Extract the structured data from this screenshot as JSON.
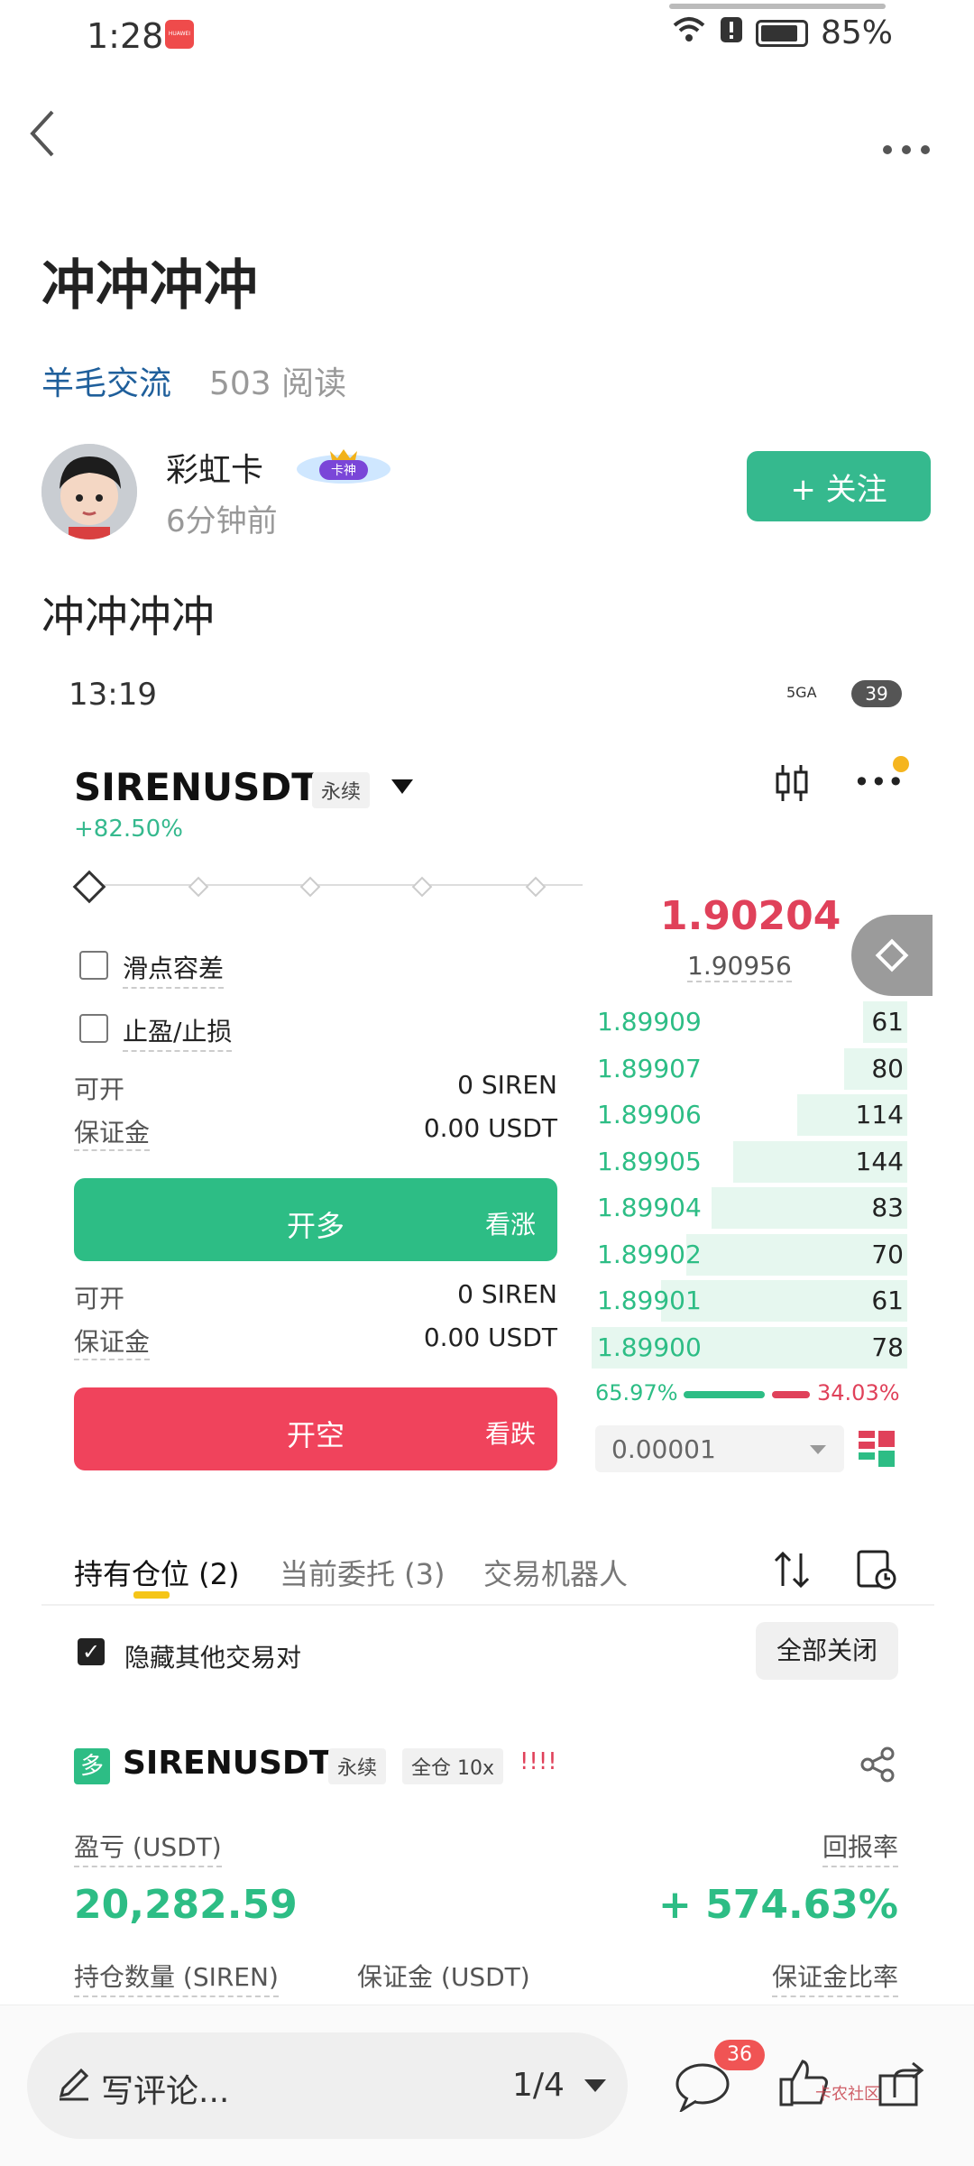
{
  "status_bar": {
    "time": "1:28",
    "battery": "85%"
  },
  "header": {
    "back_icon": "chevron-left-icon",
    "more_icon": "more-dots-icon"
  },
  "post": {
    "title": "冲冲冲冲",
    "category": "羊毛交流",
    "reads": "503 阅读",
    "author": {
      "name": "彩虹卡",
      "badge": "卡神",
      "time": "6分钟前"
    },
    "follow_label": "+ 关注",
    "content_text": "冲冲冲冲"
  },
  "screenshot": {
    "status_time": "13:19",
    "signal": "5GA",
    "battery": "39",
    "pair": "SIRENUSDT",
    "pair_tag": "永续",
    "change": "+82.50%",
    "slippage_label": "滑点容差",
    "tpsl_label": "止盈/止损",
    "long": {
      "open_label": "可开",
      "open_value": "0 SIREN",
      "margin_label": "保证金",
      "margin_value": "0.00 USDT",
      "button": "开多",
      "button_sub": "看涨"
    },
    "short": {
      "open_label": "可开",
      "open_value": "0 SIREN",
      "margin_label": "保证金",
      "margin_value": "0.00 USDT",
      "button": "开空",
      "button_sub": "看跌"
    },
    "orderbook": {
      "last_price": "1.90204",
      "mark_price": "1.90956",
      "bids": [
        {
          "price": "1.89909",
          "qty": "61",
          "depth": 0.14
        },
        {
          "price": "1.89907",
          "qty": "80",
          "depth": 0.2
        },
        {
          "price": "1.89906",
          "qty": "114",
          "depth": 0.35
        },
        {
          "price": "1.89905",
          "qty": "144",
          "depth": 0.55
        },
        {
          "price": "1.89904",
          "qty": "83",
          "depth": 0.62
        },
        {
          "price": "1.89902",
          "qty": "70",
          "depth": 0.7
        },
        {
          "price": "1.89901",
          "qty": "61",
          "depth": 0.78
        },
        {
          "price": "1.89900",
          "qty": "78",
          "depth": 1.0
        }
      ],
      "buy_ratio": "65.97%",
      "sell_ratio": "34.03%",
      "tick_size": "0.00001"
    },
    "tabs": [
      "持有仓位 (2)",
      "当前委托 (3)",
      "交易机器人"
    ],
    "hide_others_label": "隐藏其他交易对",
    "close_all_label": "全部关闭",
    "position": {
      "side": "多",
      "pair": "SIRENUSDT",
      "tag1": "永续",
      "tag2": "全仓 10x",
      "warn": "!!!!",
      "pnl_label": "盈亏 (USDT)",
      "pnl_value": "20,282.59",
      "roe_label": "回报率",
      "roe_value": "+ 574.63%",
      "qty_label": "持仓数量 (SIREN)",
      "margin_label": "保证金 (USDT)",
      "margin_ratio_label": "保证金比率"
    }
  },
  "bottom_bar": {
    "comment_placeholder": "写评论...",
    "page_indicator": "1/4",
    "comment_count": "36",
    "watermark": "卡农社区"
  },
  "colors": {
    "accent": "#35b98e",
    "green": "#2dbd85",
    "red": "#e0415a",
    "link": "#1f5f9b"
  }
}
